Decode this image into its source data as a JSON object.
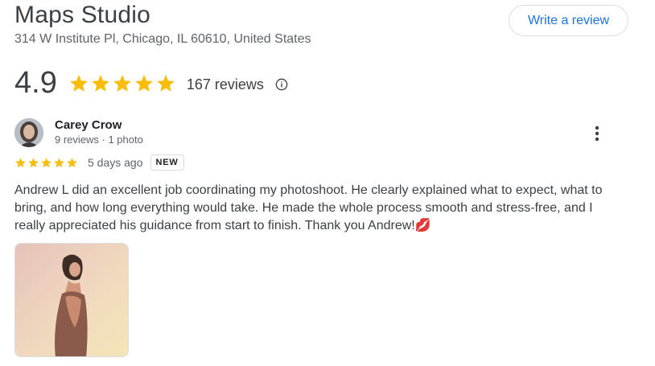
{
  "place": {
    "name": "Maps Studio",
    "address": "314 W Institute Pl, Chicago, IL 60610, United States"
  },
  "actions": {
    "write_review_label": "Write a review"
  },
  "summary": {
    "rating": "4.9",
    "stars": 5,
    "review_count": "167 reviews"
  },
  "review": {
    "author": "Carey Crow",
    "author_meta": "9 reviews · 1 photo",
    "stars": 5,
    "date": "5 days ago",
    "badge": "NEW",
    "text": "Andrew L did an excellent job coordinating my photoshoot. He clearly explained what to expect, what to bring, and how long everything would take. He made the whole process smooth and stress-free, and I really appreciated his guidance from start to finish. Thank you Andrew!💋"
  },
  "colors": {
    "star": "#fbbc04",
    "link": "#1a73e8",
    "border": "#dadce0"
  },
  "icons": {
    "star": "star-icon",
    "info": "info-icon",
    "more": "more-vert-icon"
  }
}
